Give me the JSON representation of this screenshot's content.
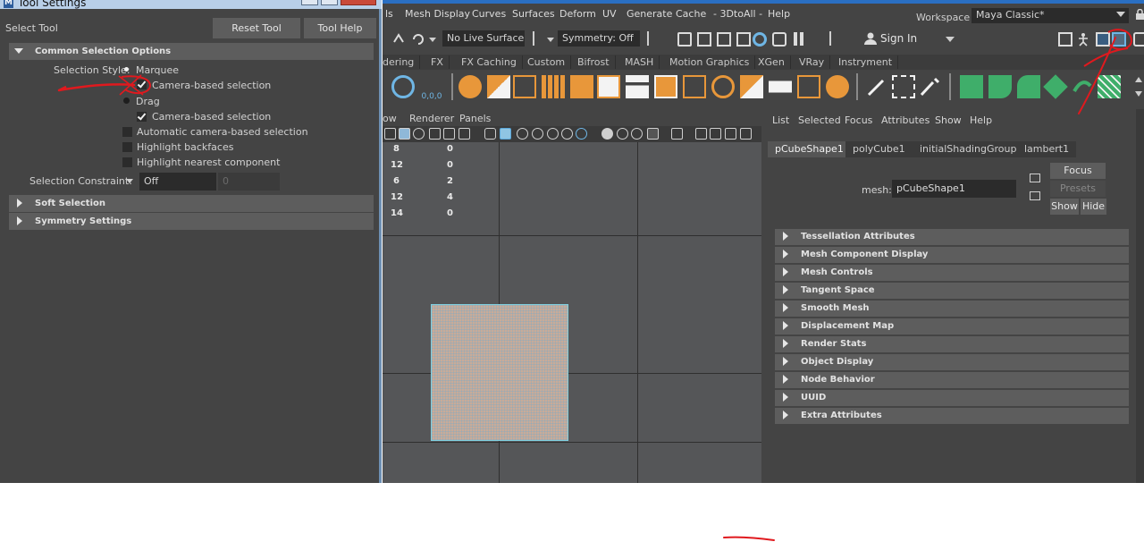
{
  "tool_settings": {
    "window_title": "Tool Settings",
    "app_icon": "M",
    "tool_name": "Select Tool",
    "reset_label": "Reset Tool",
    "help_label": "Tool Help",
    "common_frame": "Common Selection Options",
    "selection_style_label": "Selection Style:",
    "marquee_label": "Marquee",
    "marquee_camera_label": "Camera-based selection",
    "drag_label": "Drag",
    "drag_camera_label": "Camera-based selection",
    "auto_camera_label": "Automatic camera-based selection",
    "highlight_backfaces_label": "Highlight backfaces",
    "highlight_nearest_label": "Highlight nearest component",
    "constraint_label": "Selection Constraint:",
    "constraint_value": "Off",
    "constraint_number": "0",
    "soft_selection_frame": "Soft Selection",
    "symmetry_frame": "Symmetry Settings"
  },
  "menubar": {
    "items": [
      "ls",
      "Mesh Display",
      "Curves",
      "Surfaces",
      "Deform",
      "UV",
      "Generate",
      "Cache",
      "- 3DtoAll -",
      "Help"
    ],
    "workspace_label": "Workspace :",
    "workspace_value": "Maya Classic*"
  },
  "statusline": {
    "live_surface": "No Live Surface",
    "symmetry": "Symmetry: Off",
    "sign_in": "Sign In"
  },
  "shelf_tabs": [
    "dering",
    "FX",
    "FX Caching",
    "Custom",
    "Bifrost",
    "MASH",
    "Motion Graphics",
    "XGen",
    "VRay",
    "Instryment"
  ],
  "shelf_snowflake_text": "0,0,0",
  "panel_menu": [
    "ow",
    "Renderer",
    "Panels"
  ],
  "hud_stats": [
    {
      "a": "8",
      "b": "0"
    },
    {
      "a": "12",
      "b": "0"
    },
    {
      "a": "6",
      "b": "2"
    },
    {
      "a": "12",
      "b": "4"
    },
    {
      "a": "14",
      "b": "0"
    }
  ],
  "attribute_editor": {
    "menu": [
      "List",
      "Selected",
      "Focus",
      "Attributes",
      "Show",
      "Help"
    ],
    "tabs": [
      "pCubeShape1",
      "polyCube1",
      "initialShadingGroup",
      "lambert1"
    ],
    "mesh_label": "mesh:",
    "mesh_value": "pCubeShape1",
    "focus_label": "Focus",
    "presets_label": "Presets",
    "show_label": "Show",
    "hide_label": "Hide",
    "sections": [
      "Tessellation Attributes",
      "Mesh Component Display",
      "Mesh Controls",
      "Tangent Space",
      "Smooth Mesh",
      "Displacement Map",
      "Render Stats",
      "Object Display",
      "Node Behavior",
      "UUID",
      "Extra Attributes"
    ]
  },
  "colors": {
    "panel_bg": "#444444",
    "field_bg": "#2b2b2b",
    "frame_bg": "#5d5d5d",
    "viewport_bg": "#555658",
    "annotation_red": "#e0191e"
  }
}
